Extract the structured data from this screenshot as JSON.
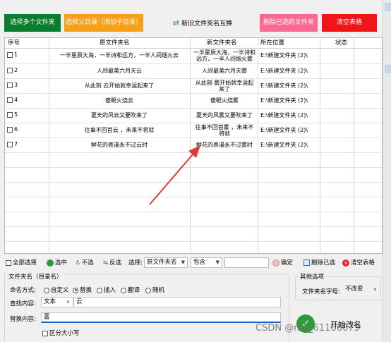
{
  "toolbar": {
    "select_files": "选择多个文件夹",
    "select_parent": "选择父目录（添加子目录）",
    "swap_names": "新旧文件夹名互换",
    "delete_selected": "删除已选的文件夹",
    "clear_table": "清空表格"
  },
  "table": {
    "headers": [
      "序号",
      "原文件夹名",
      "新文件夹名",
      "所在位置",
      "状态"
    ],
    "rows": [
      {
        "index": "1",
        "original": "一半星辰大海，一半诗和远方，一半人间烟火云",
        "new": "一半星辰大海，一半诗和远方，一半人间烟火雾",
        "location": "E:\\新建文件夹 (2)\\",
        "status": ""
      },
      {
        "index": "2",
        "original": "人间最美六月天云",
        "new": "人间最美六月天雾",
        "location": "E:\\新建文件夹 (2)\\",
        "status": ""
      },
      {
        "index": "3",
        "original": "从此刻 云开始就幸运起来了",
        "new": "从此刻 雾开始就幸运起来了",
        "location": "E:\\新建文件夹 (2)\\",
        "status": ""
      },
      {
        "index": "4",
        "original": "傻眼火烧云",
        "new": "傻眼火烧雾",
        "location": "E:\\新建文件夹 (2)\\",
        "status": ""
      },
      {
        "index": "5",
        "original": "夏天的风云又要吹来了",
        "new": "夏天的风雾又要吹来了",
        "location": "E:\\新建文件夹 (2)\\",
        "status": ""
      },
      {
        "index": "6",
        "original": "往事不回首云 ，未来不将就",
        "new": "往事不回首雾 ，未来不将就",
        "location": "E:\\新建文件夹 (2)\\",
        "status": ""
      },
      {
        "index": "7",
        "original": "鲜花的表漫永不过云时",
        "new": "鲜花的表漫永不过雾时",
        "location": "E:\\新建文件夹 (2)\\",
        "status": ""
      }
    ]
  },
  "selection_bar": {
    "select_all": "全部选择",
    "select": "选中",
    "deselect": "不选",
    "invert": "反选",
    "select_label": "选择:",
    "field_value": "原文件夹名",
    "condition_value": "包含",
    "filter_value": "",
    "confirm": "确定",
    "delete_selected": "删除已选",
    "clear_table": "清空表格"
  },
  "folder_name_section": {
    "title": "文件夹名（目录名）",
    "naming_label": "命名方式:",
    "modes": [
      "自定义",
      "替换",
      "插入",
      "翻译",
      "随机"
    ],
    "selected_mode": "替换",
    "find_label": "查找内容:",
    "find_type": "文本",
    "find_value": "云",
    "replace_label": "替换内容:",
    "replace_value": "雾",
    "case_sensitive": "区分大小写"
  },
  "other_options": {
    "title": "其他选项",
    "font_label": "文件夹名字母:",
    "font_value": "不改变"
  },
  "start_button": "开始改名",
  "watermark": "CSDN @m0_61166673",
  "colors": {
    "green": "#0a7d2f",
    "orange": "#f7a11a",
    "pink": "#f86a91",
    "red": "#f2141b",
    "arrow": "#e23b35"
  }
}
